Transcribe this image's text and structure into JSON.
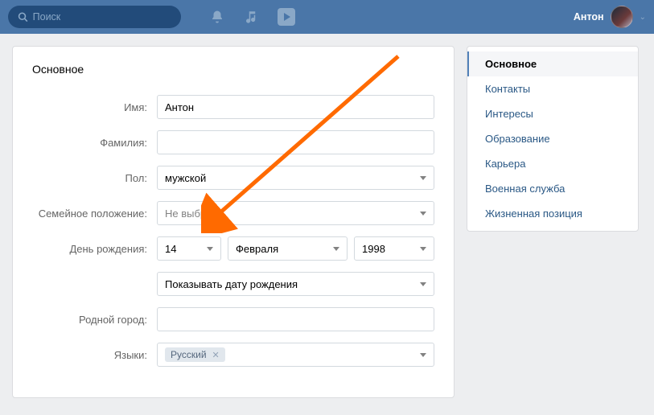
{
  "header": {
    "search_placeholder": "Поиск",
    "user_name": "Антон"
  },
  "main": {
    "title": "Основное",
    "labels": {
      "first_name": "Имя:",
      "last_name": "Фамилия:",
      "gender": "Пол:",
      "relationship": "Семейное положение:",
      "birthday": "День рождения:",
      "hometown": "Родной город:",
      "languages": "Языки:"
    },
    "values": {
      "first_name": "Антон",
      "last_name": "",
      "gender": "мужской",
      "relationship": "Не выбрано",
      "birth_day": "14",
      "birth_month": "Февраля",
      "birth_year": "1998",
      "bday_visibility": "Показывать дату рождения",
      "hometown": "",
      "language_token": "Русский"
    }
  },
  "sidebar": {
    "items": [
      "Основное",
      "Контакты",
      "Интересы",
      "Образование",
      "Карьера",
      "Военная служба",
      "Жизненная позиция"
    ]
  }
}
